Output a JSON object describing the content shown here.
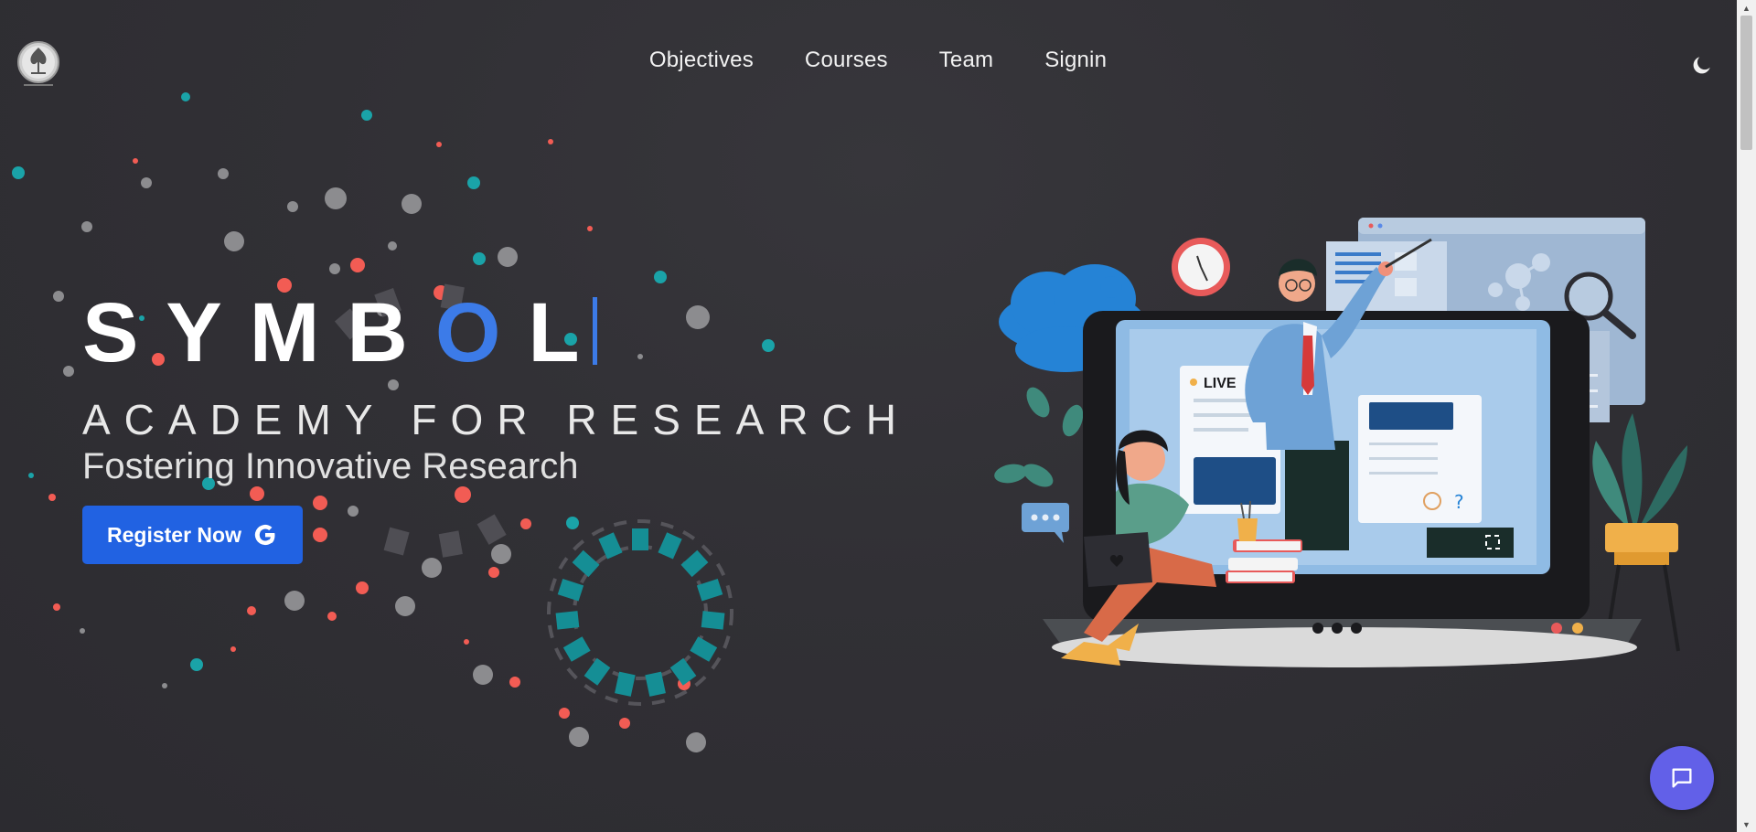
{
  "brand": {
    "logo_icon": "tree-emblem-icon"
  },
  "nav": {
    "items": [
      {
        "label": "Objectives"
      },
      {
        "label": "Courses"
      },
      {
        "label": "Team"
      },
      {
        "label": "Signin"
      }
    ],
    "theme_icon": "moon-icon"
  },
  "hero": {
    "title_main": "SYMB",
    "title_accent": "O",
    "title_end": "L",
    "subtitle": "ACADEMY FOR RESEARCH",
    "tagline": "Fostering Innovative Research",
    "register_label": "Register Now",
    "register_icon": "google-icon"
  },
  "illustration": {
    "live_label": "LIVE",
    "icon": "online-class-illustration"
  },
  "chat": {
    "icon": "chat-bubble-icon"
  },
  "colors": {
    "accent": "#3c7be8",
    "button": "#2162e2",
    "chat": "#6260e8",
    "background": "#313035",
    "particle_teal": "#1aa3a8",
    "particle_red": "#f25c54",
    "particle_grey": "#8c8c8f"
  }
}
